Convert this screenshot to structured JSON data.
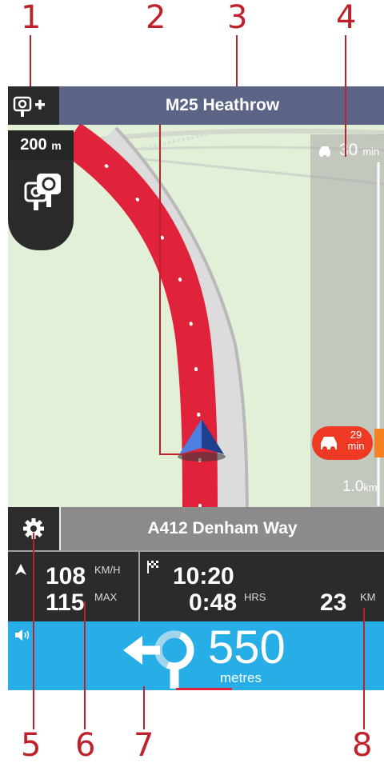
{
  "callouts": [
    "1",
    "2",
    "3",
    "4",
    "5",
    "6",
    "7",
    "8"
  ],
  "header": {
    "road_name": "M25 Heathrow"
  },
  "camera": {
    "distance_value": "200",
    "distance_unit": "m",
    "add_icon": "speed-camera-add-icon",
    "camera_icon": "speed-camera-icon"
  },
  "traffic": {
    "delay_value": "30",
    "delay_unit": "min",
    "bubble_value": "29",
    "bubble_unit": "min",
    "remaining_value": "1.0",
    "remaining_unit": "km",
    "icon": "car-icon"
  },
  "street": {
    "name": "A412 Denham Way"
  },
  "speed": {
    "current": "108",
    "current_unit": "KM/H",
    "max": "115",
    "max_label": "MAX"
  },
  "route": {
    "arrival": "10:20",
    "time_left": "0:48",
    "time_unit": "HRS",
    "distance": "23",
    "distance_unit": "KM"
  },
  "instruction": {
    "distance": "550",
    "unit": "metres",
    "maneuver_icon": "roundabout-left-icon",
    "sound_icon": "speaker-icon"
  },
  "colors": {
    "route": "#e0223a",
    "header": "#5b6485",
    "instruction_bar": "#27aee6",
    "traffic_alert": "#ee3a24",
    "callout": "#c0202a"
  }
}
